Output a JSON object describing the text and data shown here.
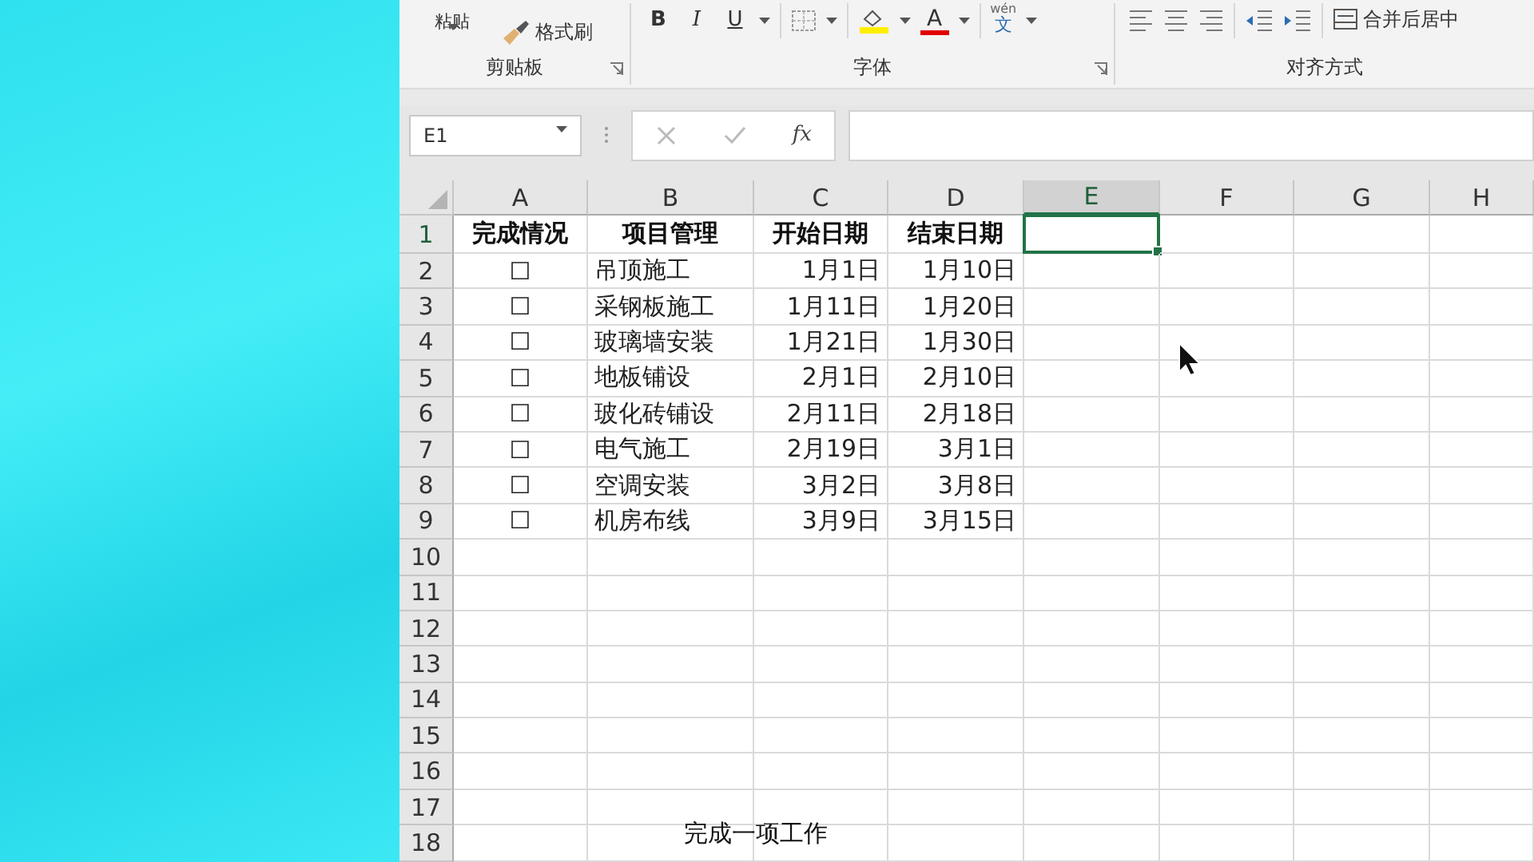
{
  "ribbon": {
    "groups": [
      {
        "kind": "clipboard",
        "paste_label": "粘贴",
        "format_painter": "格式刷",
        "label": "剪贴板"
      },
      {
        "kind": "font",
        "bold": "B",
        "italic": "I",
        "underline": "U",
        "font_color": "A",
        "phonetic_top": "wén",
        "phonetic_bottom": "文",
        "label": "字体"
      },
      {
        "kind": "alignment",
        "merge": "合并后居中",
        "label": "对齐方式"
      }
    ]
  },
  "formula_bar": {
    "name_box": "E1",
    "fx": "fx"
  },
  "sheet": {
    "columns": [
      {
        "letter": "A",
        "selected": false
      },
      {
        "letter": "B",
        "selected": false
      },
      {
        "letter": "C",
        "selected": false
      },
      {
        "letter": "D",
        "selected": false
      },
      {
        "letter": "E",
        "selected": true
      },
      {
        "letter": "F",
        "selected": false
      },
      {
        "letter": "G",
        "selected": false
      },
      {
        "letter": "H",
        "selected": false
      }
    ],
    "rows": [
      {
        "number": "1",
        "kind": "header",
        "selected": true,
        "cells": {
          "A": "完成情况",
          "B": "项目管理",
          "C": "开始日期",
          "D": "结束日期"
        }
      },
      {
        "number": "2",
        "kind": "data",
        "selected": false,
        "cells": {
          "A": "☐",
          "B": "吊顶施工",
          "C": "1月1日",
          "D": "1月10日"
        }
      },
      {
        "number": "3",
        "kind": "data",
        "selected": false,
        "cells": {
          "A": "☐",
          "B": "采钢板施工",
          "C": "1月11日",
          "D": "1月20日"
        }
      },
      {
        "number": "4",
        "kind": "data",
        "selected": false,
        "cells": {
          "A": "☐",
          "B": "玻璃墙安装",
          "C": "1月21日",
          "D": "1月30日"
        }
      },
      {
        "number": "5",
        "kind": "data",
        "selected": false,
        "cells": {
          "A": "☐",
          "B": "地板铺设",
          "C": "2月1日",
          "D": "2月10日"
        }
      },
      {
        "number": "6",
        "kind": "data",
        "selected": false,
        "cells": {
          "A": "☐",
          "B": "玻化砖铺设",
          "C": "2月11日",
          "D": "2月18日"
        }
      },
      {
        "number": "7",
        "kind": "data",
        "selected": false,
        "cells": {
          "A": "☐",
          "B": "电气施工",
          "C": "2月19日",
          "D": "3月1日"
        }
      },
      {
        "number": "8",
        "kind": "data",
        "selected": false,
        "cells": {
          "A": "☐",
          "B": "空调安装",
          "C": "3月2日",
          "D": "3月8日"
        }
      },
      {
        "number": "9",
        "kind": "data",
        "selected": false,
        "cells": {
          "A": "☐",
          "B": "机房布线",
          "C": "3月9日",
          "D": "3月15日"
        }
      },
      {
        "number": "10",
        "kind": "data",
        "selected": false,
        "cells": {}
      },
      {
        "number": "11",
        "kind": "data",
        "selected": false,
        "cells": {}
      },
      {
        "number": "12",
        "kind": "data",
        "selected": false,
        "cells": {}
      },
      {
        "number": "13",
        "kind": "data",
        "selected": false,
        "cells": {}
      },
      {
        "number": "14",
        "kind": "data",
        "selected": false,
        "cells": {}
      },
      {
        "number": "15",
        "kind": "data",
        "selected": false,
        "cells": {}
      },
      {
        "number": "16",
        "kind": "data",
        "selected": false,
        "cells": {}
      },
      {
        "number": "17",
        "kind": "data",
        "selected": false,
        "cells": {}
      },
      {
        "number": "18",
        "kind": "data",
        "selected": false,
        "cells": {}
      }
    ]
  },
  "caption": "完成一项工作"
}
